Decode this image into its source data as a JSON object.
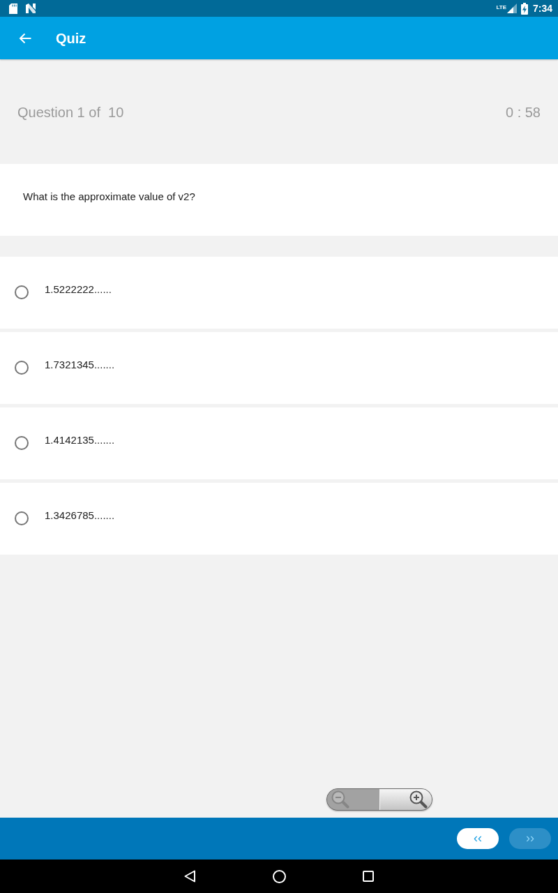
{
  "status_bar": {
    "network": "LTE",
    "time": "7:34"
  },
  "app_bar": {
    "title": "Quiz"
  },
  "quiz_header": {
    "progress": "Question 1 of  10",
    "timer": "0 : 58"
  },
  "question": {
    "text": "What is the approximate value of v2?"
  },
  "options": [
    {
      "label": "1.5222222......",
      "selected": false
    },
    {
      "label": "1.7321345.......",
      "selected": false
    },
    {
      "label": "1.4142135.......",
      "selected": false
    },
    {
      "label": "1.3426785.......",
      "selected": false
    }
  ],
  "zoom_controls": [
    {
      "kind": "zoom-out",
      "disabled": true
    },
    {
      "kind": "zoom-in",
      "disabled": false
    }
  ],
  "navigation": [
    {
      "label": "‹‹",
      "disabled": false
    },
    {
      "label": "››",
      "disabled": true
    }
  ]
}
